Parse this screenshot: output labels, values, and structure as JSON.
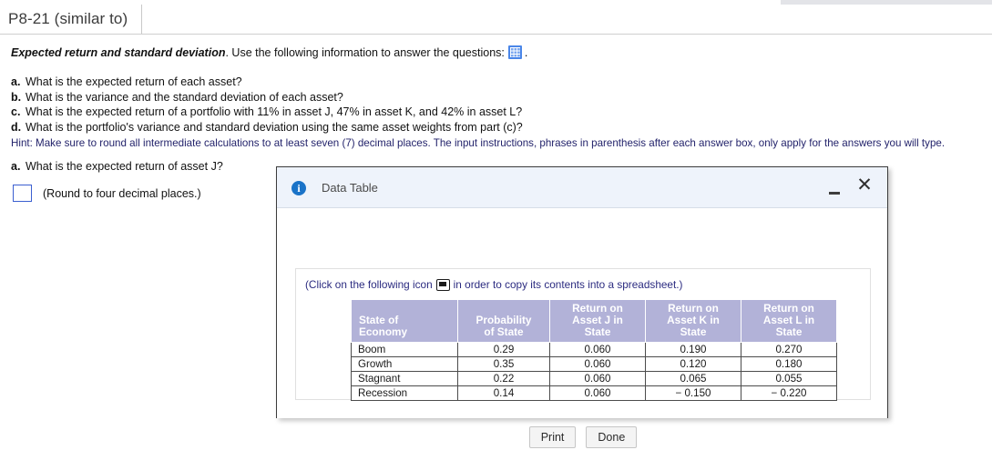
{
  "tab": {
    "label": "P8-21 (similar to)"
  },
  "problem": {
    "title_bold": "Expected return and standard deviation",
    "title_rest": ".  Use the following information to answer the questions:",
    "title_icon": "spreadsheet-grid-icon",
    "title_trailing": ".",
    "questions": [
      {
        "letter": "a.",
        "text": "What is the expected return of each asset?"
      },
      {
        "letter": "b.",
        "text": "What is the variance and the standard deviation of each asset?"
      },
      {
        "letter": "c.",
        "text": "What is the expected return of a portfolio with 11% in asset J, 47% in asset K, and 42% in asset L?"
      },
      {
        "letter": "d.",
        "text": "What is the portfolio's variance and standard deviation using the same asset weights from part (c)?"
      }
    ],
    "hint": "Hint: Make sure to round all intermediate calculations to at least seven (7) decimal places. The input instructions, phrases in parenthesis after each answer box, only apply for the answers you will type.",
    "hint_color": "#23236b",
    "sub_question": {
      "letter": "a.",
      "text": "What is the expected return of asset J?"
    },
    "answer": {
      "value": "",
      "note": "(Round to four decimal places.)",
      "border_color": "#3b5fd0"
    }
  },
  "dialog": {
    "icon": "info-icon",
    "icon_glyph": "i",
    "title": "Data Table",
    "minimize_label": "–",
    "close_label": "✕",
    "header_bg": "#eef3fb",
    "copy_instruction_before": "(Click on the following icon",
    "copy_instruction_icon": "copy-to-spreadsheet-icon",
    "copy_instruction_after": "in order to copy its contents into a spreadsheet.)",
    "table": {
      "header_bg": "#b2b2d8",
      "columns": [
        {
          "lines": [
            "State of",
            "Economy"
          ]
        },
        {
          "lines": [
            "Probability",
            "of State"
          ]
        },
        {
          "lines": [
            "Return on",
            "Asset J in",
            "State"
          ]
        },
        {
          "lines": [
            "Return on",
            "Asset K in",
            "State"
          ]
        },
        {
          "lines": [
            "Return on",
            "Asset L in",
            "State"
          ]
        }
      ],
      "rows": [
        [
          "Boom",
          "0.29",
          "0.060",
          "0.190",
          "0.270"
        ],
        [
          "Growth",
          "0.35",
          "0.060",
          "0.120",
          "0.180"
        ],
        [
          "Stagnant",
          "0.22",
          "0.060",
          "0.065",
          "0.055"
        ],
        [
          "Recession",
          "0.14",
          "0.060",
          "− 0.150",
          "− 0.220"
        ]
      ]
    },
    "buttons": {
      "print": "Print",
      "done": "Done"
    }
  }
}
